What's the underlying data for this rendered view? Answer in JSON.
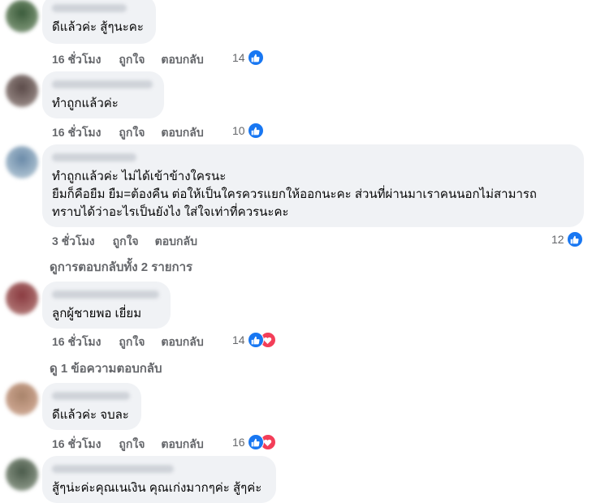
{
  "actions": {
    "like": "ถูกใจ",
    "reply": "ตอบกลับ"
  },
  "colors": {
    "accent": "#1877f2",
    "love": "#f33e58",
    "bubble": "#f0f2f5",
    "muted": "#65676b"
  },
  "comments": [
    {
      "text_lines": [
        "ดีแล้วค่ะ สู้ๆนะคะ"
      ],
      "time": "16 ชั่วโมง",
      "reactions": "14",
      "reaction_icons": [
        "like-icon"
      ]
    },
    {
      "text_lines": [
        "ทำถูกแล้วค่ะ"
      ],
      "time": "16 ชั่วโมง",
      "reactions": "10",
      "reaction_icons": [
        "like-icon"
      ]
    },
    {
      "text_lines": [
        "ทำถูกแล้วค่ะ ไม่ได้เข้าข้างใครนะ",
        "ยืมก็คือยืม ยืม=ต้องคืน ต่อให้เป็นใครควรแยกให้ออกนะคะ ส่วนที่ผ่านมาเราคนนอกไม่สามารถ",
        "ทราบได้ว่าอะไรเป็นยังไง ใส่ใจเท่าที่ควรนะคะ"
      ],
      "time": "3 ชั่วโมง",
      "reactions": "12",
      "reaction_icons": [
        "like-icon"
      ]
    },
    {
      "text_lines": [
        "ลูกผู้ชายพอ เยี่ยม"
      ],
      "time": "16 ชั่วโมง",
      "reactions": "14",
      "reaction_icons": [
        "like-icon",
        "love-icon"
      ]
    },
    {
      "text_lines": [
        "ดีแล้วค่ะ จบละ"
      ],
      "time": "16 ชั่วโมง",
      "reactions": "16",
      "reaction_icons": [
        "like-icon",
        "love-icon"
      ]
    },
    {
      "text_lines": [
        "สู้ๆน่ะค่ะคุณเนเงิน คุณเก่งมากๆค่ะ สู้ๆค่ะ"
      ]
    }
  ],
  "view_replies": [
    "ดูการตอบกลับทั้ง 2 รายการ",
    "ดู 1 ข้อความตอบกลับ"
  ]
}
